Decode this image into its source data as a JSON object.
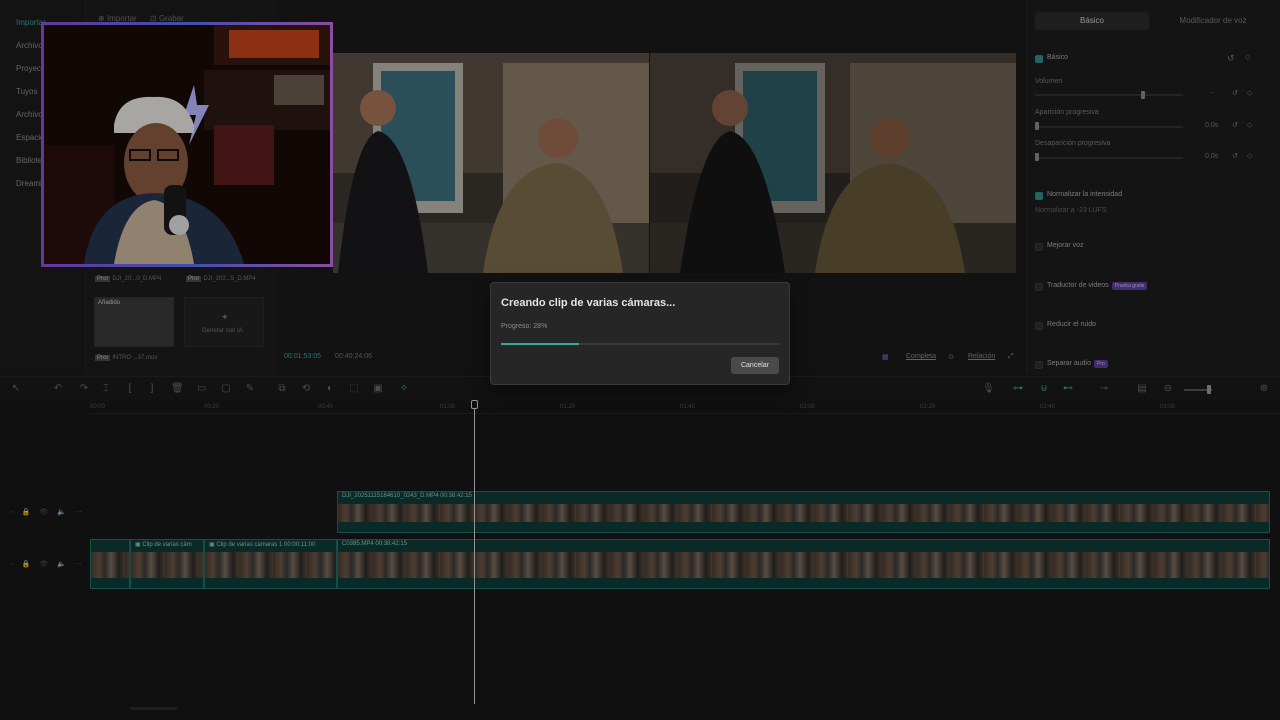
{
  "left_nav": {
    "items": [
      {
        "label": "Importar",
        "active": true
      },
      {
        "label": "Archivo",
        "active": false
      },
      {
        "label": "Proyectos",
        "active": false
      },
      {
        "label": "Tuyos",
        "active": false
      },
      {
        "label": "Archivos",
        "active": false
      },
      {
        "label": "Espacio",
        "active": false
      },
      {
        "label": "Biblioteca",
        "active": false
      },
      {
        "label": "Dreamina",
        "active": false
      }
    ]
  },
  "media": {
    "import_label": "Importar",
    "record_label": "Grabar",
    "thumbs": [
      {
        "tag": "Pror",
        "name": "DJI_20...0_D.MP4"
      },
      {
        "tag": "Pror",
        "name": "DJI_202...5_D.MP4"
      },
      {
        "tag": "Pror",
        "name": "INTRO ...37.mov",
        "added": "Añadido"
      }
    ],
    "generate_label": "Generar con IA"
  },
  "preview": {
    "time_current": "00:01:53:05",
    "time_total": "00:40:24:06",
    "full_label": "Completa",
    "ratio_label": "Relación"
  },
  "right_panel": {
    "tabs": [
      "Básico",
      "Modificador de voz"
    ],
    "active_tab": 0,
    "section_basic": "Básico",
    "volume_label": "Volumen",
    "volume_value": "-",
    "fade_in_label": "Aparición progresiva",
    "fade_in_value": "0.0s",
    "fade_out_label": "Desaparición progresiva",
    "fade_out_value": "0.0s",
    "normalize_label": "Normalizar la intensidad",
    "normalize_sub": "Normalizar a -23 LUFS",
    "enhance_voice_label": "Mejorar voz",
    "translator_label": "Traductor de videos",
    "translator_badge": "Prueba gratis",
    "reduce_noise_label": "Reducir el ruido",
    "separate_audio_label": "Separar audio",
    "separate_badge": "Pro"
  },
  "timeline": {
    "ruler": [
      "00:00",
      "00:20",
      "00:40",
      "01:00",
      "01:20",
      "01:40",
      "02:00",
      "02:20",
      "02:40",
      "03:00",
      "03:20"
    ],
    "track1_clip_title": "DJI_20251115184610_0243_D.MP4   00:38:42:15",
    "track2_clip_a1": "Clip de varias cám",
    "track2_clip_a2": "Clip de varias cámaras 1   00:00:11:00",
    "track2_clip_b": "C0385.MP4   00:38:42:15"
  },
  "dialog": {
    "title": "Creando clip de varias cámaras...",
    "progress_label": "Progreso: 28%",
    "progress": 0.28,
    "cancel_label": "Cancelar"
  }
}
